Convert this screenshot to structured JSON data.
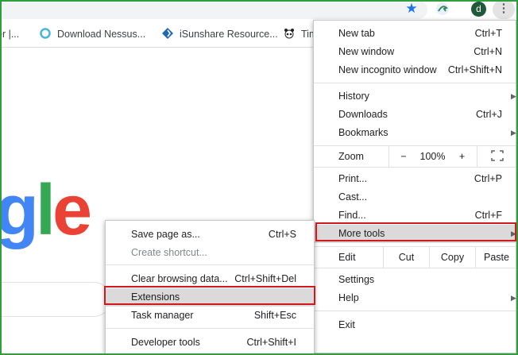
{
  "toolbar": {
    "star_icon": "star-icon",
    "avatar_letter": "d",
    "menu_icon": "⋮"
  },
  "bookmarks": [
    {
      "label": "er |...",
      "icon": "page-icon"
    },
    {
      "label": "Download Nessus...",
      "icon": "nessus-icon"
    },
    {
      "label": "iSunshare Resource...",
      "icon": "isunshare-icon"
    },
    {
      "label": "Tim",
      "icon": "panda-icon"
    }
  ],
  "google_logo": {
    "g": "g",
    "l": "l",
    "e": "e"
  },
  "main_menu": {
    "new_tab": {
      "label": "New tab",
      "shortcut": "Ctrl+T"
    },
    "new_window": {
      "label": "New window",
      "shortcut": "Ctrl+N"
    },
    "new_incognito": {
      "label": "New incognito window",
      "shortcut": "Ctrl+Shift+N"
    },
    "history": {
      "label": "History"
    },
    "downloads": {
      "label": "Downloads",
      "shortcut": "Ctrl+J"
    },
    "bookmarks": {
      "label": "Bookmarks"
    },
    "zoom": {
      "label": "Zoom",
      "minus": "−",
      "level": "100%",
      "plus": "+"
    },
    "print": {
      "label": "Print...",
      "shortcut": "Ctrl+P"
    },
    "cast": {
      "label": "Cast..."
    },
    "find": {
      "label": "Find...",
      "shortcut": "Ctrl+F"
    },
    "more_tools": {
      "label": "More tools"
    },
    "edit": {
      "label": "Edit",
      "cut": "Cut",
      "copy": "Copy",
      "paste": "Paste"
    },
    "settings": {
      "label": "Settings"
    },
    "help": {
      "label": "Help"
    },
    "exit": {
      "label": "Exit"
    }
  },
  "sub_menu": {
    "save_page": {
      "label": "Save page as...",
      "shortcut": "Ctrl+S"
    },
    "create_shortcut": {
      "label": "Create shortcut..."
    },
    "clear_browsing": {
      "label": "Clear browsing data...",
      "shortcut": "Ctrl+Shift+Del"
    },
    "extensions": {
      "label": "Extensions"
    },
    "task_manager": {
      "label": "Task manager",
      "shortcut": "Shift+Esc"
    },
    "developer_tools": {
      "label": "Developer tools",
      "shortcut": "Ctrl+Shift+I"
    }
  },
  "colors": {
    "highlight_border": "#d4171d",
    "frame_border": "#2e9e3e",
    "hover_bg": "#dadada",
    "accent_blue": "#1a73e8"
  }
}
